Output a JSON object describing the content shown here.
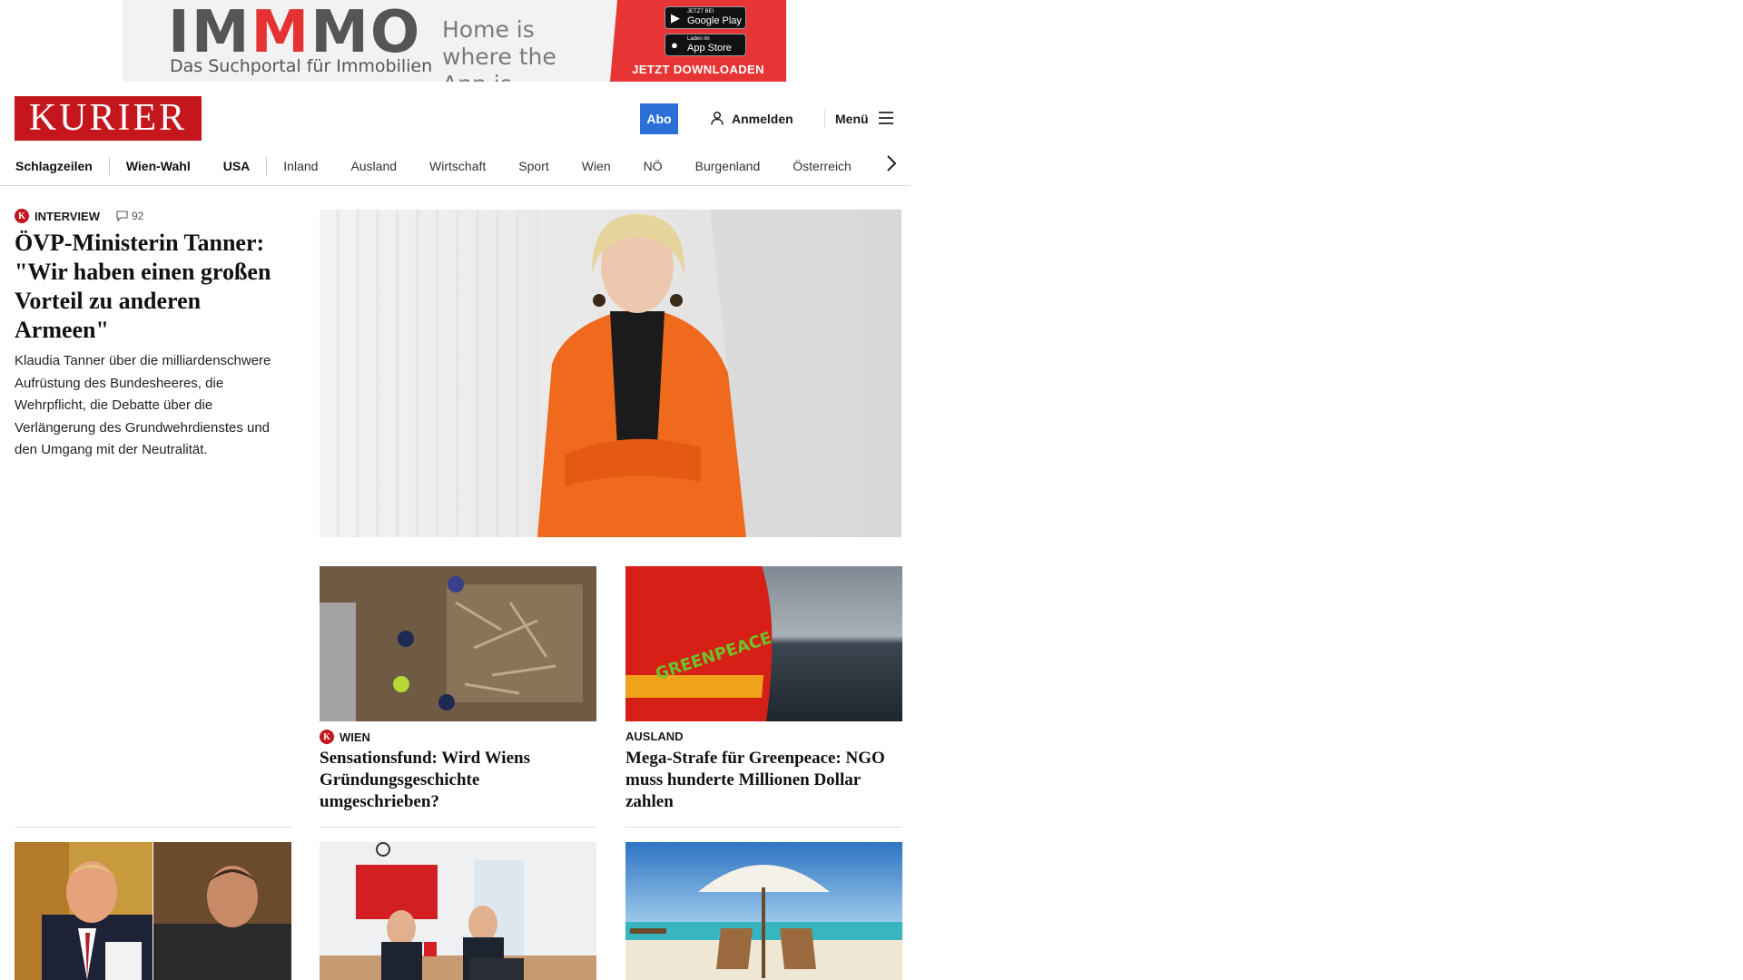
{
  "ad": {
    "brand_prefix": "IM",
    "brand_highlight": "M",
    "brand_suffix": "MO",
    "brand_subtitle": "Das Suchportal für Immobilien",
    "claim": "Home is where the App is.",
    "google_play_small": "JETZT BEI",
    "google_play_label": "Google Play",
    "app_store_small": "Laden im",
    "app_store_label": "App Store",
    "cta": "JETZT DOWNLOADEN",
    "colors": {
      "accent": "#e73434",
      "background": "#f2f2f2"
    }
  },
  "header": {
    "logo_text": "KURIER",
    "abo_label": "Abo",
    "login_label": "Anmelden",
    "menu_label": "Menü",
    "colors": {
      "brand": "#c4161c",
      "abo": "#2b6fd8"
    }
  },
  "nav": {
    "items": [
      {
        "label": "Schlagzeilen"
      },
      {
        "label": "Wien-Wahl"
      },
      {
        "label": "USA"
      },
      {
        "label": "Inland"
      },
      {
        "label": "Ausland"
      },
      {
        "label": "Wirtschaft"
      },
      {
        "label": "Sport"
      },
      {
        "label": "Wien"
      },
      {
        "label": "NÖ"
      },
      {
        "label": "Burgenland"
      },
      {
        "label": "Österreich"
      }
    ],
    "next_icon": "chevron-right-icon"
  },
  "lead": {
    "badge": "K",
    "kicker": "INTERVIEW",
    "comments": "92",
    "title": "ÖVP-Ministerin Tanner: \"Wir haben einen großen Vorteil zu anderen Armeen\"",
    "teaser": "Klaudia Tanner über die milliardenschwere Aufrüstung des Bundesheeres, die Wehrpflicht, die Debatte über die Verlängerung des Grundwehrdienstes und den Umgang mit der Neutralität."
  },
  "teasers": [
    {
      "badge": "K",
      "kicker": "WIEN",
      "title": "Sensationsfund: Wird Wiens Gründungsgeschichte umgeschrieben?"
    },
    {
      "badge": "",
      "kicker": "AUSLAND",
      "title": "Mega-Strafe für Greenpeace: NGO muss hunderte Millionen Dollar zahlen"
    }
  ]
}
